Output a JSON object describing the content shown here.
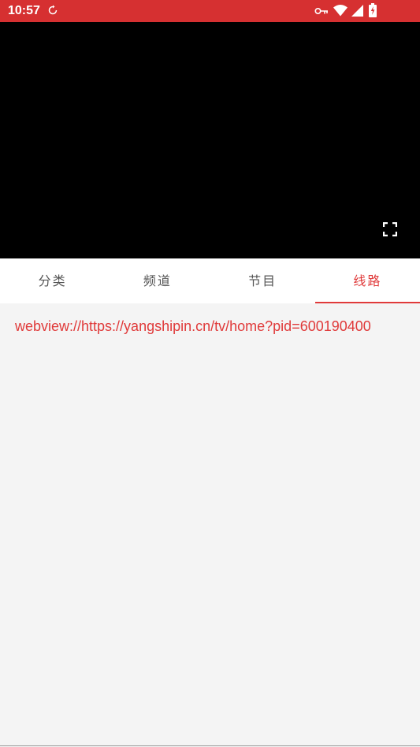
{
  "status_bar": {
    "time": "10:57",
    "bg_color": "#d63031",
    "icons": [
      "sync-icon",
      "vpn-key-icon",
      "wifi-icon",
      "signal-icon",
      "battery-icon"
    ]
  },
  "player": {
    "bg_color": "#000000",
    "controls": [
      "fullscreen-icon"
    ]
  },
  "tabs": [
    {
      "label": "分类",
      "active": false
    },
    {
      "label": "频道",
      "active": false
    },
    {
      "label": "节目",
      "active": false
    },
    {
      "label": "线路",
      "active": true
    }
  ],
  "routes": [
    {
      "label": "webview://https://yangshipin.cn/tv/home?pid=600190400"
    }
  ],
  "accent_color": "#e03a3a"
}
